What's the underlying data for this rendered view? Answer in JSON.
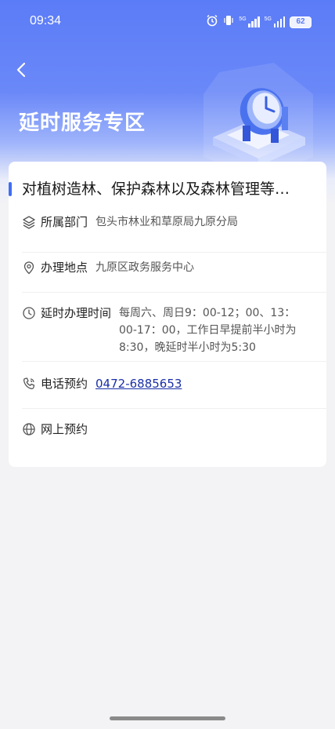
{
  "status_bar": {
    "time": "09:34",
    "network_1": "5G",
    "network_2": "5G",
    "battery": "62"
  },
  "header": {
    "title": "延时服务专区",
    "accent_color": "#5b7cf7"
  },
  "service": {
    "title": "对植树造林、保护森林以及森林管理等…",
    "rows": [
      {
        "icon": "layers-icon",
        "label": "所属部门",
        "value": "包头市林业和草原局九原分局"
      },
      {
        "icon": "location-pin-icon",
        "label": "办理地点",
        "value": "九原区政务服务中心"
      },
      {
        "icon": "clock-icon",
        "label": "延时办理时间",
        "value": "每周六、周日9：00-12；00、13：00-17：00，工作日早提前半小时为8:30，晚延时半小时为5:30"
      },
      {
        "icon": "phone-icon",
        "label": "电话预约",
        "value": "0472-6885653"
      },
      {
        "icon": "globe-icon",
        "label": "网上预约",
        "value": ""
      }
    ]
  }
}
